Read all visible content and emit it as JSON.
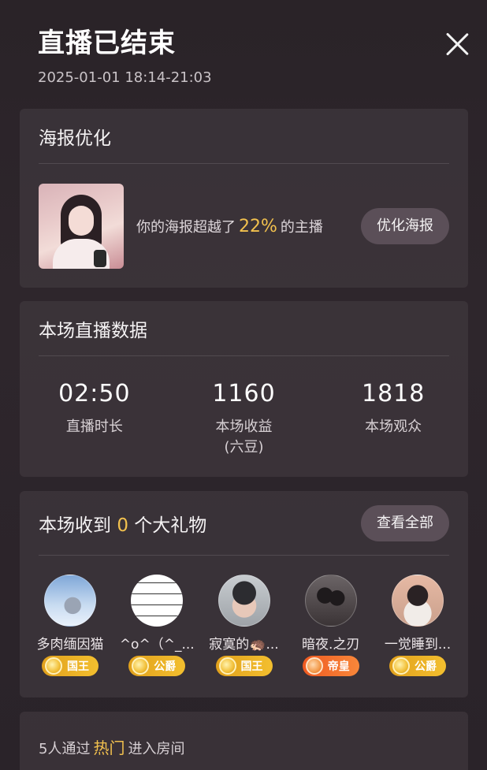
{
  "header": {
    "title": "直播已结束",
    "time_range": "2025-01-01 18:14-21:03"
  },
  "poster": {
    "section_title": "海报优化",
    "text_before": "你的海报超越了",
    "percent": "22%",
    "text_after": "的主播",
    "button_label": "优化海报"
  },
  "stats": {
    "section_title": "本场直播数据",
    "items": [
      {
        "value": "02:50",
        "label": "直播时长",
        "sublabel": ""
      },
      {
        "value": "1160",
        "label": "本场收益",
        "sublabel": "(六豆)"
      },
      {
        "value": "1818",
        "label": "本场观众",
        "sublabel": ""
      }
    ]
  },
  "gifts": {
    "title_before": "本场收到",
    "count": "0",
    "title_after": "个大礼物",
    "view_all_label": "查看全部",
    "gifters": [
      {
        "name": "多肉缅因猫",
        "rank": "国王"
      },
      {
        "name": "^o^（^_...",
        "rank": "公爵"
      },
      {
        "name": "寂寞的🦔...",
        "rank": "国王"
      },
      {
        "name": "暗夜.之刃",
        "rank": "帝皇"
      },
      {
        "name": "一觉睡到...",
        "rank": "公爵"
      }
    ]
  },
  "footer": {
    "text_before": "5人通过",
    "highlight": "热门",
    "text_after": "进入房间"
  }
}
